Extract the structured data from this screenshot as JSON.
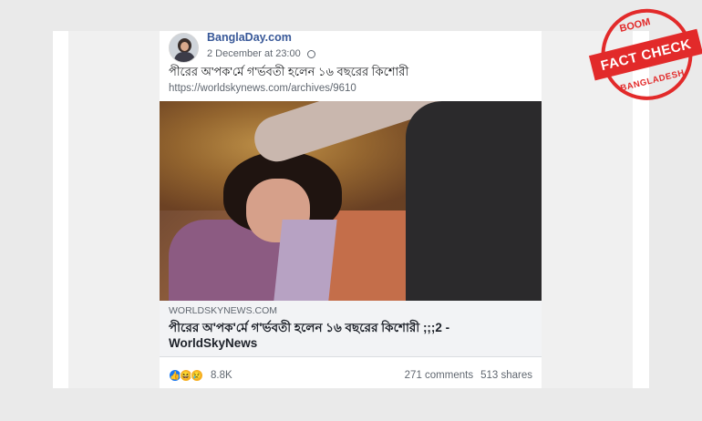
{
  "post": {
    "page_name": "BanglaDay.com",
    "timestamp": "2 December at 23:00",
    "text": "পীরের অ'পক'র্মে গ'র্ভবতী হলেন ১৬ বছরের কিশোরী",
    "url": "https://worldskynews.com/archives/9610"
  },
  "link_preview": {
    "domain": "WORLDSKYNEWS.COM",
    "title": "পীরের অ'পক'র্মে গ'র্ভবতী হলেন ১৬ বছরের কিশোরী ;;;2 - WorldSkyNews"
  },
  "engagement": {
    "reaction_count": "8.8K",
    "comments": "271 comments",
    "shares": "513 shares"
  },
  "stamp": {
    "top": "BOOM",
    "main": "FACT CHECK",
    "bottom": "BANGLADESH",
    "color": "#e22a2a"
  },
  "icons": {
    "globe": "globe-icon",
    "like": "like-reaction-icon",
    "haha": "haha-reaction-icon",
    "sad": "sad-reaction-icon"
  }
}
